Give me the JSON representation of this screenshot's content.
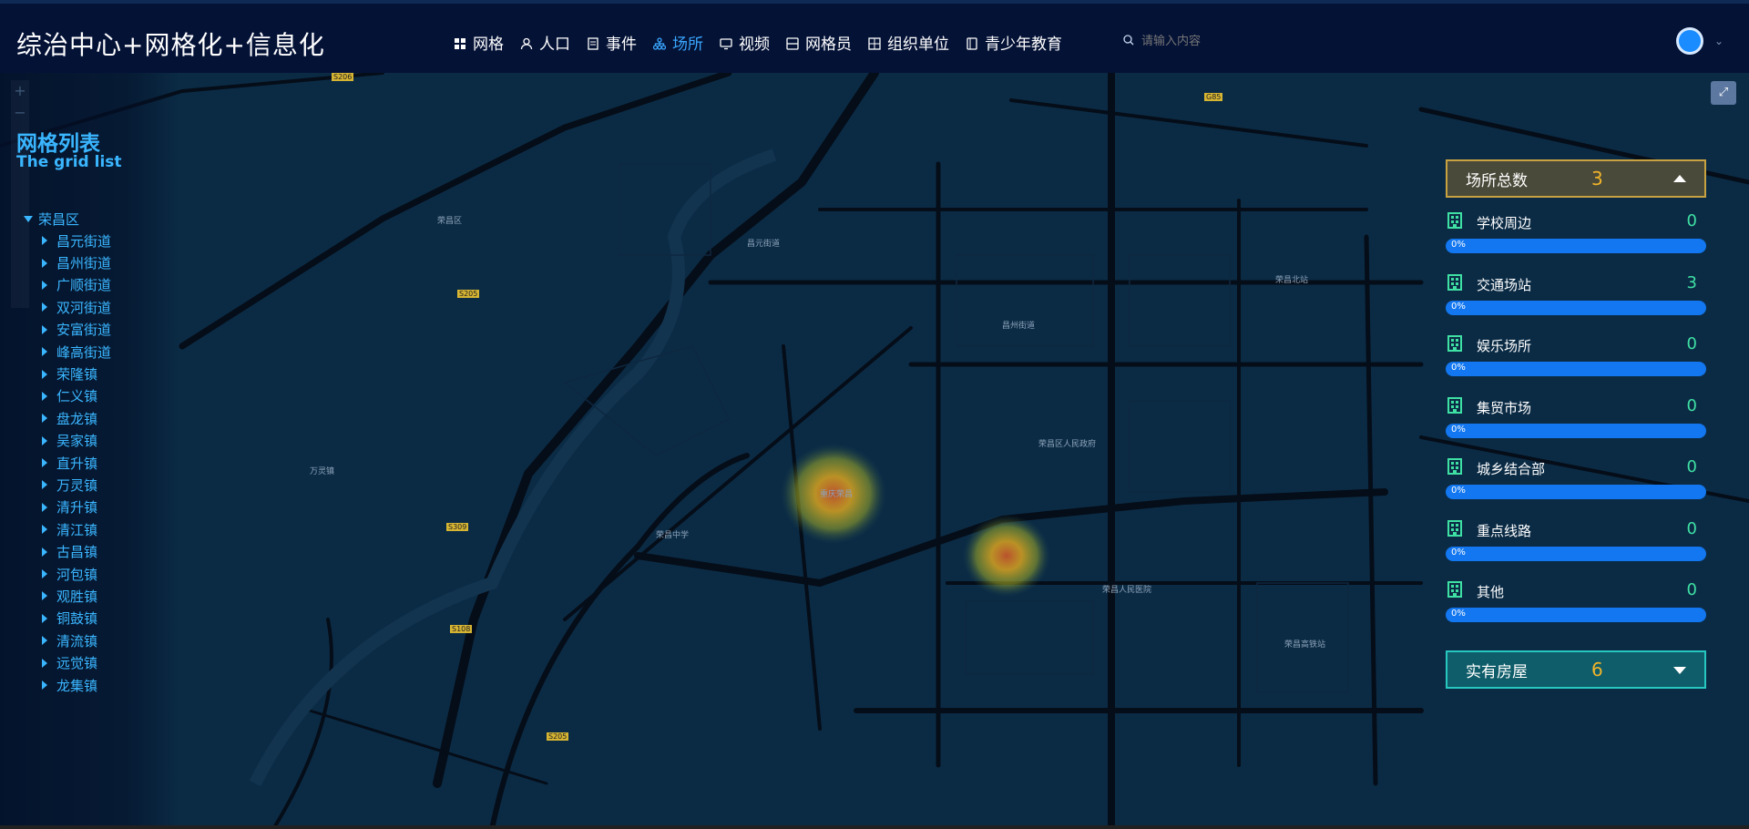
{
  "app": {
    "title": "综治中心+网格化+信息化"
  },
  "nav": {
    "items": [
      {
        "label": "网格",
        "icon": "grid-icon",
        "active": false
      },
      {
        "label": "人口",
        "icon": "person-icon",
        "active": false
      },
      {
        "label": "事件",
        "icon": "document-icon",
        "active": false
      },
      {
        "label": "场所",
        "icon": "org-tree-icon",
        "active": true
      },
      {
        "label": "视频",
        "icon": "monitor-icon",
        "active": false
      },
      {
        "label": "网格员",
        "icon": "id-card-icon",
        "active": false
      },
      {
        "label": "组织单位",
        "icon": "building-grid-icon",
        "active": false
      },
      {
        "label": "青少年教育",
        "icon": "book-icon",
        "active": false
      }
    ],
    "active_color": "#3aa7ff"
  },
  "search": {
    "placeholder": "请输入内容",
    "icon": "search-icon"
  },
  "user": {
    "avatar_icon": "user-avatar-icon"
  },
  "grid_list": {
    "title": "网格列表",
    "subtitle": "The grid list",
    "root": "荣昌区",
    "items": [
      "昌元街道",
      "昌州街道",
      "广顺街道",
      "双河街道",
      "安富街道",
      "峰高街道",
      "荣隆镇",
      "仁义镇",
      "盘龙镇",
      "吴家镇",
      "直升镇",
      "万灵镇",
      "清升镇",
      "清江镇",
      "古昌镇",
      "河包镇",
      "观胜镇",
      "铜鼓镇",
      "清流镇",
      "远觉镇",
      "龙集镇"
    ]
  },
  "places_panel": {
    "header": "场所总数",
    "total": "3",
    "categories": [
      {
        "label": "学校周边",
        "count": "0",
        "percent": "0%"
      },
      {
        "label": "交通场站",
        "count": "3",
        "percent": "0%"
      },
      {
        "label": "娱乐场所",
        "count": "0",
        "percent": "0%"
      },
      {
        "label": "集贸市场",
        "count": "0",
        "percent": "0%"
      },
      {
        "label": "城乡结合部",
        "count": "0",
        "percent": "0%"
      },
      {
        "label": "重点线路",
        "count": "0",
        "percent": "0%"
      },
      {
        "label": "其他",
        "count": "0",
        "percent": "0%"
      }
    ],
    "colors": {
      "header_border": "#c8a241",
      "count": "#f0b429",
      "cat_count": "#3fe0a4",
      "bar": "#1277f0"
    }
  },
  "housing_panel": {
    "header": "实有房屋",
    "total": "6"
  },
  "map": {
    "labels": [
      "荣昌区",
      "昌元街道",
      "昌州街道",
      "荣昌区人民政府",
      "重庆荣昌",
      "荣昌北站",
      "荣昌中学",
      "荣昌人民医院",
      "万灵镇",
      "荣昌高铁站"
    ],
    "shields": [
      "S206",
      "G85",
      "S205",
      "S309",
      "S108",
      "S205"
    ]
  }
}
